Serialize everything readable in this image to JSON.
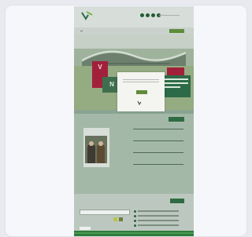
{
  "header": {
    "logo_text": "",
    "social_icons": [
      "social-icon-1",
      "social-icon-2",
      "social-icon-3",
      "social-icon-4"
    ],
    "nav_button": ""
  },
  "modal": {
    "title": "",
    "small_label": "",
    "button_label": "",
    "logo_text": ""
  },
  "section_two": {
    "left_title": "",
    "right_title": "",
    "button_label": "",
    "event_card_label": "",
    "news": [
      {
        "date": "",
        "title": ""
      },
      {
        "date": "",
        "title": ""
      },
      {
        "date": "",
        "title": ""
      },
      {
        "date": "",
        "title": ""
      }
    ]
  },
  "section_three": {
    "left_title": "",
    "right_title": ""
  },
  "colors": {
    "brand_green": "#2f6b42",
    "accent_red": "#a1213b",
    "button_green": "#5f8c3b"
  }
}
